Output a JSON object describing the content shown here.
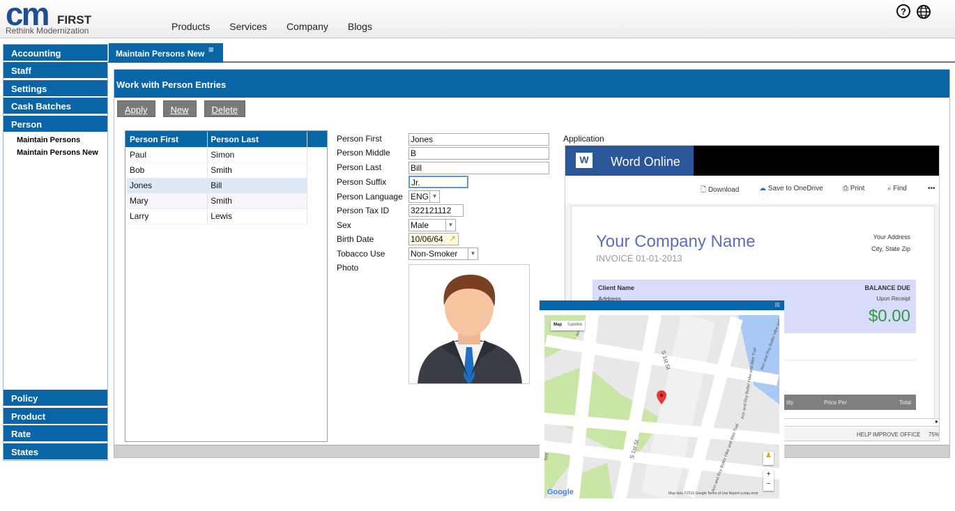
{
  "brand": {
    "logo_main": "cm",
    "logo_suffix": "FIRST",
    "tagline": "Rethink Modernization"
  },
  "nav": [
    "Products",
    "Services",
    "Company",
    "Blogs"
  ],
  "sidebar": {
    "top_items": [
      "Accounting",
      "Staff",
      "Settings",
      "Cash Batches",
      "Person"
    ],
    "sub_items": [
      "Maintain Persons",
      "Maintain Persons New"
    ],
    "bottom_items": [
      "Policy",
      "Product",
      "Rate",
      "States"
    ]
  },
  "tab": {
    "label": "Maintain Persons New"
  },
  "panel": {
    "title": "Work with Person Entries"
  },
  "buttons": {
    "apply": "Apply",
    "new": "New",
    "delete": "Delete"
  },
  "grid": {
    "headers": [
      "Person First",
      "Person Last"
    ],
    "rows": [
      [
        "Paul",
        "Simon"
      ],
      [
        "Bob",
        "Smith"
      ],
      [
        "Jones",
        "Bill"
      ],
      [
        "Mary",
        "Smith"
      ],
      [
        "Larry",
        "Lewis"
      ]
    ],
    "selected_row": 2
  },
  "form": {
    "person_first": {
      "label": "Person First",
      "value": "Jones"
    },
    "person_middle": {
      "label": "Person Middle",
      "value": "B"
    },
    "person_last": {
      "label": "Person Last",
      "value": "Bill"
    },
    "person_suffix": {
      "label": "Person Suffix",
      "value": "Jr."
    },
    "person_language": {
      "label": "Person Language",
      "value": "ENG"
    },
    "person_tax_id": {
      "label": "Person Tax ID",
      "value": "322121112"
    },
    "sex": {
      "label": "Sex",
      "value": "Male"
    },
    "birth_date": {
      "label": "Birth Date",
      "value": "10/06/64"
    },
    "tobacco_use": {
      "label": "Tobacco Use",
      "value": "Non-Smoker"
    },
    "photo": {
      "label": "Photo"
    }
  },
  "application": {
    "label": "Application",
    "word": {
      "app_name": "Word Online",
      "toolbar": [
        "Download",
        "Save to OneDrive",
        "Print",
        "Find",
        "•••"
      ],
      "company": "Your Company Name",
      "invoice": "INVOICE   01-01-2013",
      "address_line1": "Your Address",
      "address_line2": "City, State Zip",
      "client_name": "Client Name",
      "client_address": "Address",
      "balance_due": "BALANCE DUE",
      "upon_receipt": "Upon Receipt",
      "amount": "$0.00",
      "table_cols": [
        "tity",
        "Price Per",
        "Total"
      ],
      "footer": "HELP IMPROVE OFFICE",
      "zoom": "75%"
    }
  },
  "map": {
    "types": [
      "Map",
      "Satellite"
    ],
    "streets": [
      "S 1st St",
      "S 1st St",
      "Ann and Roy Butler Hike and Bike Trail",
      "Ann and Roy Butler Hike and Bike Trail",
      "Ann and Roy Butler Hike and Bike Tr",
      "Ann a",
      "Roy"
    ],
    "google": "Google",
    "attribution": "Map data ©2016 Google    Terms of Use    Report a map error"
  },
  "colors": {
    "accent": "#0a65a6",
    "park": "#c9e6a7",
    "water": "#a8c9f5",
    "marker": "#e53935"
  }
}
